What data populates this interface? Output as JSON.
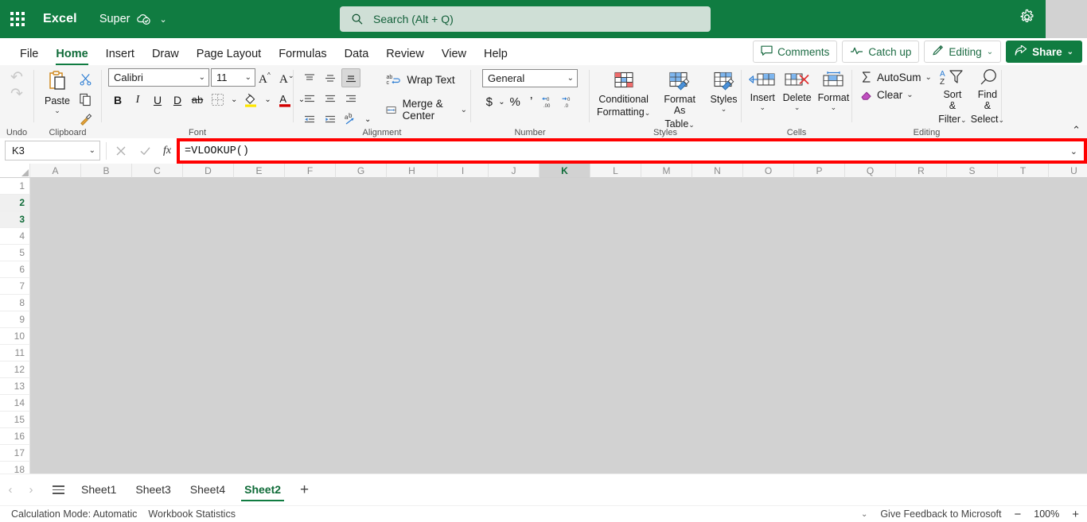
{
  "titlebar": {
    "waffle_label": "app-launcher",
    "app_name": "Excel",
    "doc_name": "Super",
    "doc_chevron": "⌄",
    "search_placeholder": "Search (Alt + Q)",
    "search_value": ""
  },
  "tabs": [
    {
      "label": "File",
      "active": false
    },
    {
      "label": "Home",
      "active": true
    },
    {
      "label": "Insert",
      "active": false
    },
    {
      "label": "Draw",
      "active": false
    },
    {
      "label": "Page Layout",
      "active": false
    },
    {
      "label": "Formulas",
      "active": false
    },
    {
      "label": "Data",
      "active": false
    },
    {
      "label": "Review",
      "active": false
    },
    {
      "label": "View",
      "active": false
    },
    {
      "label": "Help",
      "active": false
    }
  ],
  "tabstrip_right": {
    "comments": "Comments",
    "catch_up": "Catch up",
    "editing": "Editing",
    "editing_chevron": "⌄",
    "share": "Share",
    "share_chevron": "⌄"
  },
  "ribbon": {
    "undo_group_label": "Undo",
    "clipboard": {
      "group_label": "Clipboard",
      "paste_label": "Paste",
      "paste_caret": "⌄"
    },
    "font": {
      "group_label": "Font",
      "family": "Calibri",
      "size": "11",
      "grow_label": "A",
      "shrink_label": "A",
      "bold": "B",
      "italic": "I",
      "underline": "U",
      "double_underline": "D",
      "strikethrough": "ab",
      "borders_caret": "⌄",
      "fill_caret": "⌄",
      "fontcolor_caret": "⌄"
    },
    "alignment": {
      "group_label": "Alignment",
      "wrap_text": "Wrap Text",
      "merge_center": "Merge & Center",
      "merge_caret": "⌄",
      "orientation_caret": "⌄"
    },
    "number": {
      "group_label": "Number",
      "format": "General",
      "currency": "$",
      "currency_caret": "⌄",
      "percent": "%",
      "comma": "’",
      "increase_decimal": "←.00",
      "decrease_decimal": "→.0"
    },
    "styles": {
      "group_label": "Styles",
      "conditional_formatting": "Conditional\nFormatting",
      "conditional_formatting_l1": "Conditional",
      "conditional_formatting_l2": "Formatting",
      "format_as_table_l1": "Format As",
      "format_as_table_l2": "Table",
      "styles_label": "Styles",
      "caret": "⌄"
    },
    "cells": {
      "group_label": "Cells",
      "insert": "Insert",
      "delete": "Delete",
      "format": "Format",
      "caret": "⌄"
    },
    "editing": {
      "group_label": "Editing",
      "autosum": "AutoSum",
      "autosum_caret": "⌄",
      "clear": "Clear",
      "clear_caret": "⌄",
      "sort_filter_l1": "Sort &",
      "sort_filter_l2": "Filter",
      "find_select_l1": "Find &",
      "find_select_l2": "Select",
      "caret": "⌄"
    },
    "collapse_icon": "⌃"
  },
  "formula_bar": {
    "name_box": "K3",
    "name_box_chevron": "⌄",
    "cancel_icon": "×",
    "confirm_icon": "✓",
    "fx_icon": "fx",
    "formula": "=VLOOKUP()",
    "expand_chevron": "⌄",
    "highlight_color": "#ff0000"
  },
  "grid": {
    "columns": [
      "A",
      "B",
      "C",
      "D",
      "E",
      "F",
      "G",
      "H",
      "I",
      "J",
      "K",
      "L",
      "M",
      "N",
      "O",
      "P",
      "Q",
      "R",
      "S",
      "T",
      "U"
    ],
    "highlighted_column": "K",
    "rows": [
      "1",
      "2",
      "3",
      "4",
      "5",
      "6",
      "7",
      "8",
      "9",
      "10",
      "11",
      "12",
      "13",
      "14",
      "15",
      "16",
      "17",
      "18"
    ],
    "highlighted_rows": [
      "2",
      "3"
    ],
    "active_cell": "K3"
  },
  "sheets": {
    "prev_icon": "‹",
    "next_icon": "›",
    "menu_label": "all-sheets",
    "items": [
      {
        "label": "Sheet1",
        "active": false
      },
      {
        "label": "Sheet3",
        "active": false
      },
      {
        "label": "Sheet4",
        "active": false
      },
      {
        "label": "Sheet2",
        "active": true
      }
    ],
    "add_label": "+"
  },
  "statusbar": {
    "calculation_mode": "Calculation Mode: Automatic",
    "workbook_statistics": "Workbook Statistics",
    "options_chevron": "⌄",
    "feedback": "Give Feedback to Microsoft",
    "zoom_out": "−",
    "zoom_level": "100%",
    "zoom_in": "+"
  },
  "colors": {
    "brand_green": "#107c41",
    "search_bg": "#cfdfd6",
    "ribbon_bg": "#f5f5f5",
    "grid_overlay": "#d2d2d2",
    "highlight_red": "#ff0000"
  }
}
